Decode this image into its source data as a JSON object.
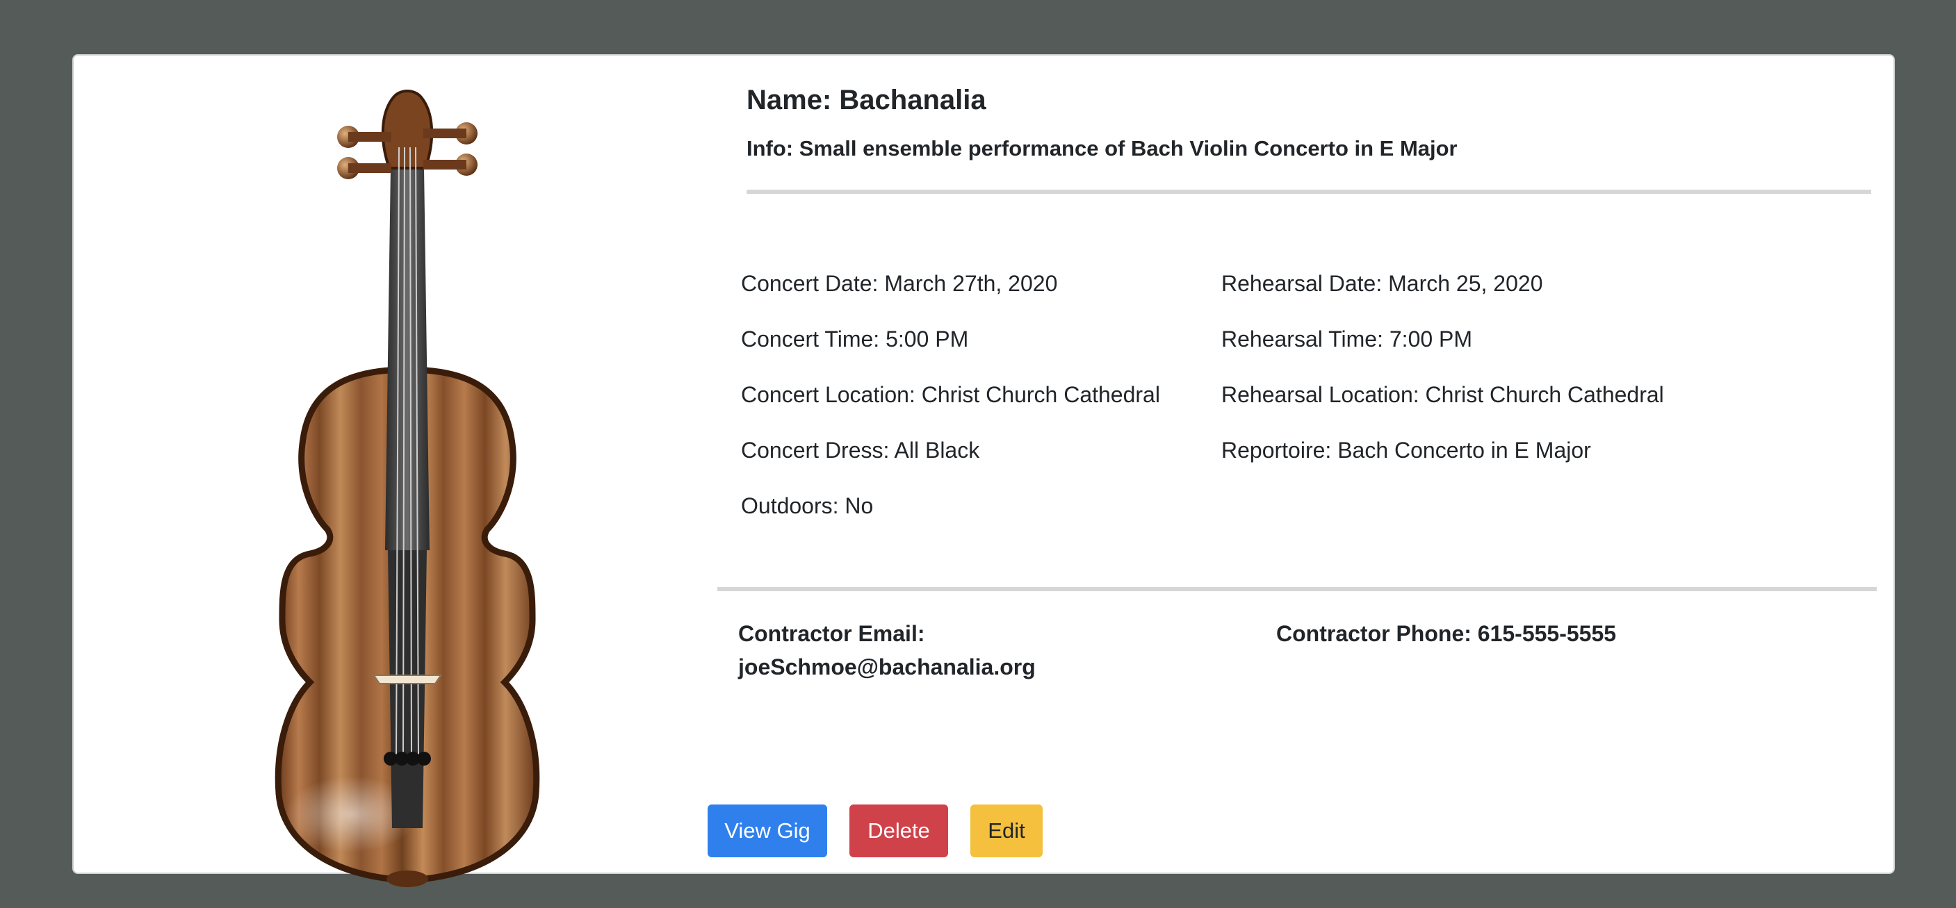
{
  "gig": {
    "name": "Name: Bachanalia",
    "info": "Info: Small ensemble performance of Bach Violin Concerto in E Major"
  },
  "details": {
    "concert_date": "Concert Date: March 27th, 2020",
    "concert_time": "Concert Time: 5:00 PM",
    "concert_location": "Concert Location: Christ Church Cathedral",
    "concert_dress": "Concert Dress: All Black",
    "outdoors": "Outdoors: No",
    "rehearsal_date": "Rehearsal Date: March 25, 2020",
    "rehearsal_time": "Rehearsal Time: 7:00 PM",
    "rehearsal_location": "Rehearsal Location: Christ Church Cathedral",
    "reportoire": "Reportoire: Bach Concerto in E Major"
  },
  "contractor": {
    "email_label": "Contractor Email:",
    "email": "joeSchmoe@bachanalia.org",
    "phone": "Contractor Phone: 615-555-5555"
  },
  "buttons": {
    "view": "View Gig",
    "delete": "Delete",
    "edit": "Edit"
  },
  "image": {
    "subject": "violin-illustration"
  },
  "colors": {
    "background": "#555b59",
    "card": "#ffffff",
    "primary": "#2f80ed",
    "danger": "#d0424a",
    "warning": "#f5c03e"
  }
}
